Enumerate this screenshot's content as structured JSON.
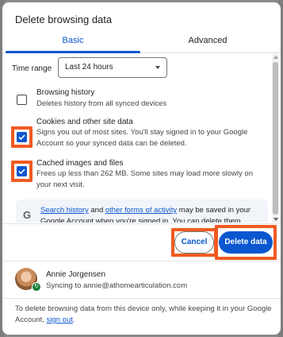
{
  "dialog": {
    "title": "Delete browsing data"
  },
  "tabs": [
    {
      "label": "Basic",
      "selected": true
    },
    {
      "label": "Advanced",
      "selected": false
    }
  ],
  "time_range": {
    "label": "Time range",
    "selected": "Last 24 hours"
  },
  "options": [
    {
      "title": "Browsing history",
      "description": "Deletes history from all synced devices",
      "checked": false
    },
    {
      "title": "Cookies and other site data",
      "description": "Signs you out of most sites. You'll stay signed in to your Google Account so your synced data can be deleted.",
      "checked": true
    },
    {
      "title": "Cached images and files",
      "description": "Frees up less than 262 MB. Some sites may load more slowly on your next visit.",
      "checked": true
    }
  ],
  "info": {
    "link1": "Search history",
    "text1": " and ",
    "link2": "other forms of activity",
    "text2": " may be saved in your Google Account when you're signed in. You can delete them anytime."
  },
  "buttons": {
    "cancel": "Cancel",
    "delete": "Delete data"
  },
  "account": {
    "name": "Annie Jorgensen",
    "sync_status": "Syncing to annie@athomearticulation.com"
  },
  "footer": {
    "text": "To delete browsing data from this device only, while keeping it in your Google Account, ",
    "link": "sign out",
    "end": "."
  },
  "colors": {
    "accent": "#0b57d0",
    "highlight": "#f05a22"
  }
}
